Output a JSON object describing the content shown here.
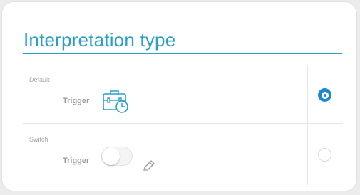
{
  "header": {
    "title": "Interpretation type"
  },
  "options": [
    {
      "label": "Default",
      "trigger_label": "Trigger",
      "icon": "briefcase-clock-icon",
      "selected": true
    },
    {
      "label": "Switch",
      "trigger_label": "Trigger",
      "icon": "toggle-switch",
      "secondary_icon": "pencil-icon",
      "selected": false
    }
  ],
  "colors": {
    "accent": "#2aa0c8",
    "radio_selected": "#1b8bd0",
    "divider": "#e6e6e6"
  }
}
